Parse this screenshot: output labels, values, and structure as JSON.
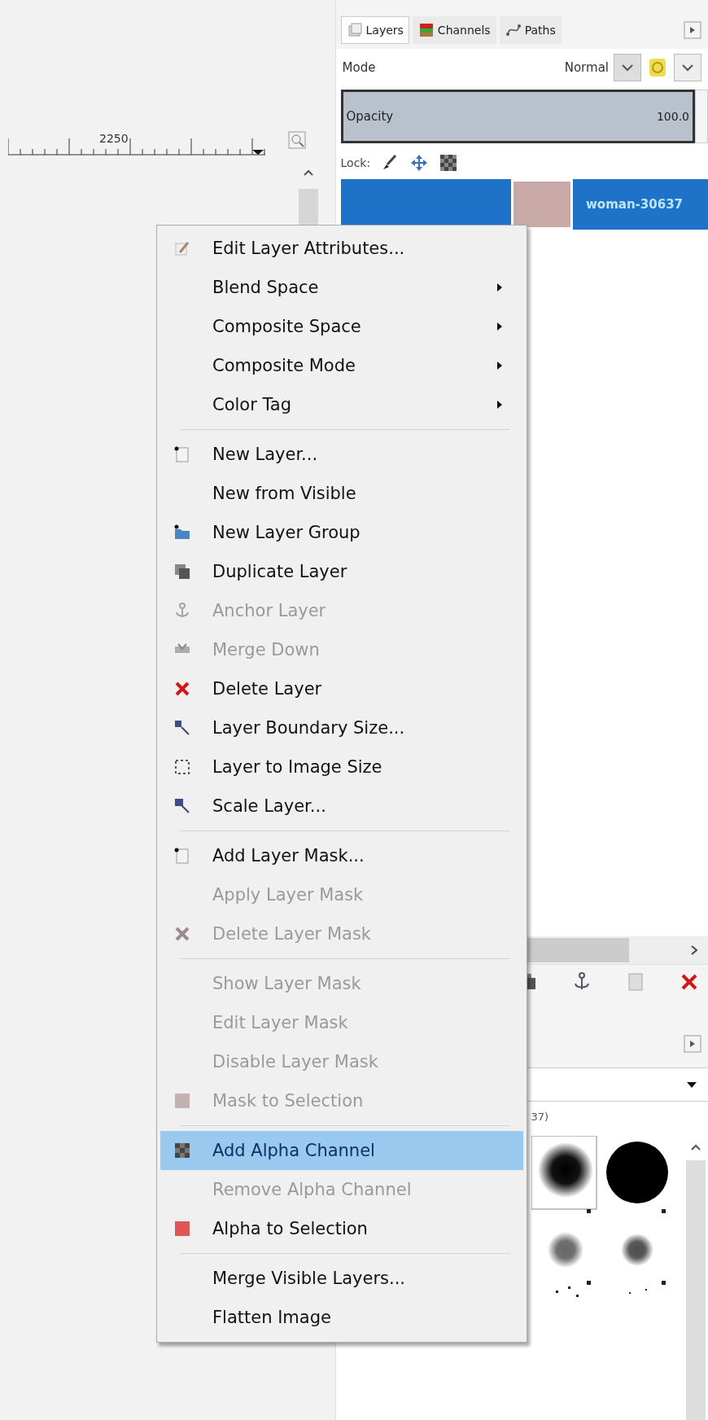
{
  "canvas": {
    "ruler_label": "2250"
  },
  "layers_dock": {
    "tabs": [
      {
        "label": "Layers",
        "selected": true
      },
      {
        "label": "Channels",
        "selected": false
      },
      {
        "label": "Paths",
        "selected": false
      }
    ],
    "mode": {
      "label": "Mode",
      "value": "Normal"
    },
    "opacity": {
      "label": "Opacity",
      "value": "100.0",
      "level": 1
    },
    "lock": {
      "label": "Lock:"
    },
    "layers": [
      {
        "name": "woman-30637",
        "selected": true
      }
    ]
  },
  "brushes_dock": {
    "label": "37)"
  },
  "context_menu": {
    "groups": [
      [
        {
          "label": "Edit Layer Attributes...",
          "disabled": false,
          "selected": false,
          "submenu": false
        },
        {
          "label": "Blend Space",
          "disabled": false,
          "selected": false,
          "submenu": true
        },
        {
          "label": "Composite Space",
          "disabled": false,
          "selected": false,
          "submenu": true
        },
        {
          "label": "Composite Mode",
          "disabled": false,
          "selected": false,
          "submenu": true
        },
        {
          "label": "Color Tag",
          "disabled": false,
          "selected": false,
          "submenu": true
        }
      ],
      [
        {
          "label": "New Layer...",
          "disabled": false,
          "selected": false,
          "submenu": false
        },
        {
          "label": "New from Visible",
          "disabled": false,
          "selected": false,
          "submenu": false
        },
        {
          "label": "New Layer Group",
          "disabled": false,
          "selected": false,
          "submenu": false
        },
        {
          "label": "Duplicate Layer",
          "disabled": false,
          "selected": false,
          "submenu": false
        },
        {
          "label": "Anchor Layer",
          "disabled": true,
          "selected": false,
          "submenu": false
        },
        {
          "label": "Merge Down",
          "disabled": true,
          "selected": false,
          "submenu": false
        },
        {
          "label": "Delete Layer",
          "disabled": false,
          "selected": false,
          "submenu": false
        },
        {
          "label": "Layer Boundary Size...",
          "disabled": false,
          "selected": false,
          "submenu": false
        },
        {
          "label": "Layer to Image Size",
          "disabled": false,
          "selected": false,
          "submenu": false
        },
        {
          "label": "Scale Layer...",
          "disabled": false,
          "selected": false,
          "submenu": false
        }
      ],
      [
        {
          "label": "Add Layer Mask...",
          "disabled": false,
          "selected": false,
          "submenu": false
        },
        {
          "label": "Apply Layer Mask",
          "disabled": true,
          "selected": false,
          "submenu": false
        },
        {
          "label": "Delete Layer Mask",
          "disabled": true,
          "selected": false,
          "submenu": false
        }
      ],
      [
        {
          "label": "Show Layer Mask",
          "disabled": true,
          "selected": false,
          "submenu": false
        },
        {
          "label": "Edit Layer Mask",
          "disabled": true,
          "selected": false,
          "submenu": false
        },
        {
          "label": "Disable Layer Mask",
          "disabled": true,
          "selected": false,
          "submenu": false
        },
        {
          "label": "Mask to Selection",
          "disabled": true,
          "selected": false,
          "submenu": false
        }
      ],
      [
        {
          "label": "Add Alpha Channel",
          "disabled": false,
          "selected": true,
          "submenu": false
        },
        {
          "label": "Remove Alpha Channel",
          "disabled": true,
          "selected": false,
          "submenu": false
        },
        {
          "label": "Alpha to Selection",
          "disabled": false,
          "selected": false,
          "submenu": false
        }
      ],
      [
        {
          "label": "Merge Visible Layers...",
          "disabled": false,
          "selected": false,
          "submenu": false
        },
        {
          "label": "Flatten Image",
          "disabled": false,
          "selected": false,
          "submenu": false
        }
      ]
    ]
  }
}
